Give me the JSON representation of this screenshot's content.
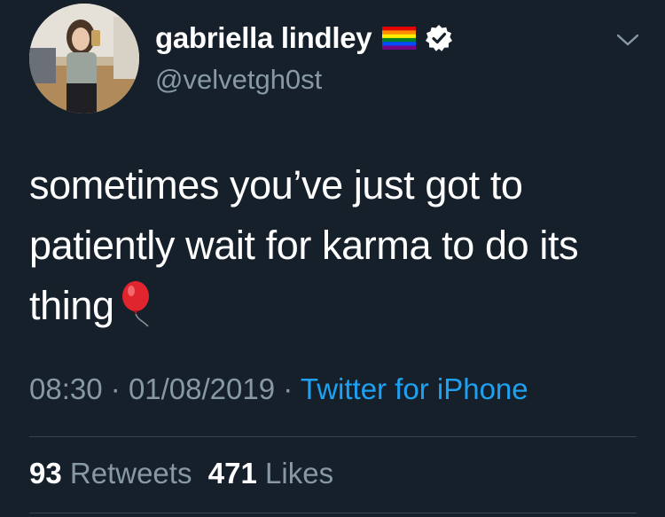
{
  "user": {
    "display_name": "gabriella lindley",
    "handle": "@velvetgh0st",
    "flag_icon": "rainbow-flag-icon",
    "verified_icon": "verified-badge-icon"
  },
  "tweet": {
    "text_line1": "sometimes you’ve just got to",
    "text_line2": "patiently wait for karma to do its",
    "text_line3": "thing",
    "emoji": "balloon-icon"
  },
  "meta": {
    "time": "08:30",
    "date": "01/08/2019",
    "separator": "·",
    "source": "Twitter for iPhone"
  },
  "stats": {
    "retweets_count": "93",
    "retweets_label": "Retweets",
    "likes_count": "471",
    "likes_label": "Likes"
  },
  "colors": {
    "background": "#16202b",
    "secondary_text": "#8899a6",
    "link": "#1da1f2",
    "divider": "#38444d"
  }
}
